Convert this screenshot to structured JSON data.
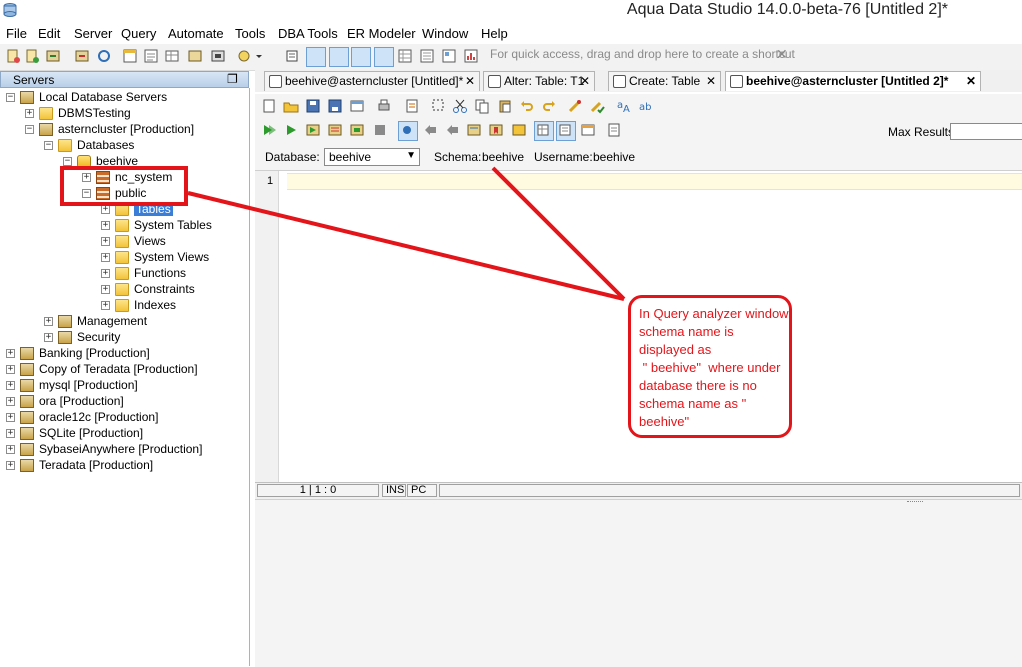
{
  "window": {
    "title": "Aqua Data Studio 14.0.0-beta-76 [Untitled 2]*"
  },
  "menu": [
    "File",
    "Edit",
    "Server",
    "Query",
    "Automate",
    "Tools",
    "DBA Tools",
    "ER Modeler",
    "Window",
    "Help"
  ],
  "toolbar": {
    "quick_access": "For quick access, drag and drop here to create a shortcut",
    "quick_close": "✕"
  },
  "servers_panel": {
    "title": "Servers",
    "restore": "❐",
    "tree": [
      {
        "label": "Local Database Servers",
        "level": 0,
        "icon": "server-group-icon",
        "expanded": true
      },
      {
        "label": "DBMSTesting",
        "level": 1,
        "icon": "folder-icon",
        "expanded": false
      },
      {
        "label": "asterncluster [Production]",
        "level": 1,
        "icon": "server-icon",
        "expanded": true
      },
      {
        "label": "Databases",
        "level": 2,
        "icon": "databases-folder-icon",
        "expanded": true
      },
      {
        "label": "beehive",
        "level": 3,
        "icon": "database-icon",
        "expanded": true
      },
      {
        "label": "nc_system",
        "level": 4,
        "icon": "schema-icon",
        "expanded": false
      },
      {
        "label": "public",
        "level": 4,
        "icon": "schema-icon",
        "expanded": true
      },
      {
        "label": "Tables",
        "level": 5,
        "icon": "folder-icon",
        "expanded": false,
        "selected": true
      },
      {
        "label": "System Tables",
        "level": 5,
        "icon": "folder-icon",
        "expanded": false
      },
      {
        "label": "Views",
        "level": 5,
        "icon": "folder-icon",
        "expanded": false
      },
      {
        "label": "System Views",
        "level": 5,
        "icon": "folder-icon",
        "expanded": false
      },
      {
        "label": "Functions",
        "level": 5,
        "icon": "folder-icon",
        "expanded": false
      },
      {
        "label": "Constraints",
        "level": 5,
        "icon": "folder-icon",
        "expanded": false
      },
      {
        "label": "Indexes",
        "level": 5,
        "icon": "folder-icon",
        "expanded": false
      },
      {
        "label": "Management",
        "level": 2,
        "icon": "management-icon",
        "expanded": false
      },
      {
        "label": "Security",
        "level": 2,
        "icon": "security-icon",
        "expanded": false
      },
      {
        "label": "Banking [Production]",
        "level": 0,
        "icon": "server-icon",
        "expanded": false
      },
      {
        "label": "Copy of Teradata [Production]",
        "level": 0,
        "icon": "server-icon",
        "expanded": false
      },
      {
        "label": "mysql [Production]",
        "level": 0,
        "icon": "server-icon",
        "expanded": false
      },
      {
        "label": "ora [Production]",
        "level": 0,
        "icon": "server-icon",
        "expanded": false
      },
      {
        "label": "oracle12c [Production]",
        "level": 0,
        "icon": "server-icon",
        "expanded": false
      },
      {
        "label": "SQLite [Production]",
        "level": 0,
        "icon": "server-icon",
        "expanded": false
      },
      {
        "label": "SybaseiAnywhere [Production]",
        "level": 0,
        "icon": "server-icon",
        "expanded": false
      },
      {
        "label": "Teradata [Production]",
        "level": 0,
        "icon": "server-icon",
        "expanded": false
      }
    ]
  },
  "tabs": [
    {
      "label": "beehive@asterncluster [Untitled]*",
      "active": false
    },
    {
      "label": "Alter: Table: T1",
      "active": false
    },
    {
      "label": "Create: Table",
      "active": false
    },
    {
      "label": "beehive@asterncluster [Untitled 2]*",
      "active": true
    }
  ],
  "tab_close": "✕",
  "editor_toolbar": {
    "max_results_label": "Max Results:",
    "max_results_value": ""
  },
  "connection_bar": {
    "database_label": "Database:",
    "database_value": "beehive",
    "schema_label": "Schema:",
    "schema_value": "beehive",
    "username_label": "Username:",
    "username_value": "beehive"
  },
  "editor": {
    "line_number": "1"
  },
  "status": {
    "position": "1 | 1 : 0",
    "mode": "INS",
    "pc": "PC"
  },
  "annotation": {
    "callout": "In Query analyzer window schema name is displayed as\n \" beehive\"  where under database there is no schema name as \" beehive\"",
    "color": "#e3151a"
  }
}
